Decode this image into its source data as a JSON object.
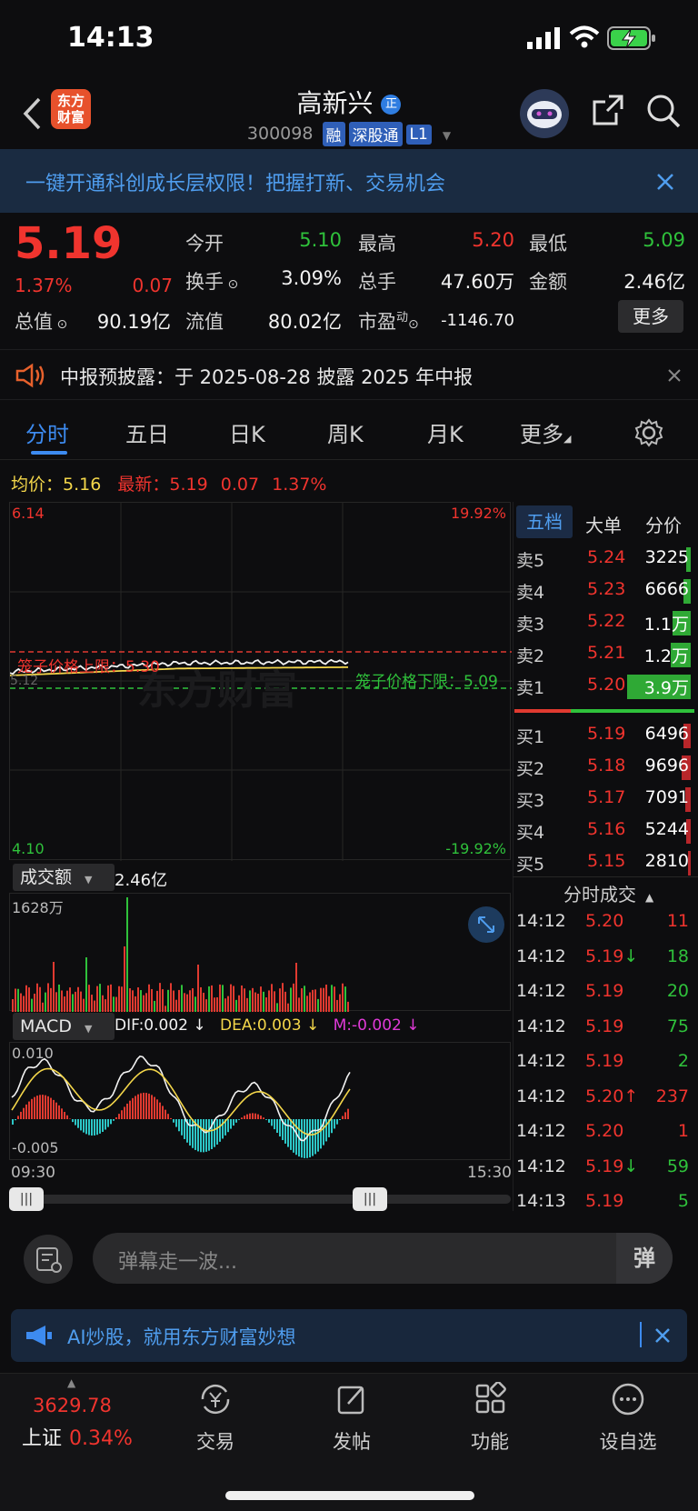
{
  "status": {
    "time": "14:13"
  },
  "header": {
    "logo_text": "东方\n财富",
    "logo_line1": "东方",
    "logo_line2": "财富",
    "stock_name": "高新兴",
    "name_badge": "正",
    "stock_code": "300098",
    "tags": [
      "融",
      "深股通",
      "L1"
    ]
  },
  "banner": {
    "text": "一键开通科创成长层权限！把握打新、交易机会"
  },
  "quote": {
    "price": "5.19",
    "change_pct": "1.37%",
    "change": "0.07",
    "fields": [
      {
        "label": "今开",
        "value": "5.10",
        "color": "green"
      },
      {
        "label": "最高",
        "value": "5.20",
        "color": "red"
      },
      {
        "label": "最低",
        "value": "5.09",
        "color": "green"
      },
      {
        "label": "换手",
        "value": "3.09%",
        "color": "white"
      },
      {
        "label": "总手",
        "value": "47.60万",
        "color": "white"
      },
      {
        "label": "金额",
        "value": "2.46亿",
        "color": "white"
      },
      {
        "label": "总值",
        "value": "90.19亿",
        "color": "white"
      },
      {
        "label": "流值",
        "value": "80.02亿",
        "color": "white"
      },
      {
        "label": "市盈",
        "value": "-1146.70",
        "color": "white"
      }
    ],
    "pe_sup": "动",
    "more_button": "更多"
  },
  "notice": {
    "text": "中报预披露：于 2025-08-28 披露 2025 年中报"
  },
  "tabs": [
    "分时",
    "五日",
    "日K",
    "周K",
    "月K",
    "更多"
  ],
  "chart_info": {
    "avg_label": "均价：",
    "avg_value": "5.16",
    "latest_label": "最新：",
    "latest_value": "5.19",
    "latest_change": "0.07",
    "latest_pct": "1.37%"
  },
  "chart": {
    "max_price": "6.14",
    "max_pct": "19.92%",
    "min_price": "4.10",
    "min_pct": "-19.92%",
    "upper_limit_label": "笼子价格上限：5.30",
    "lower_limit_label": "笼子价格下限：5.09",
    "prev_close_label": "5.12",
    "watermark": "东方财富"
  },
  "volume": {
    "selector": "成交额",
    "total": "2.46亿",
    "max_label": "1628万"
  },
  "macd": {
    "selector": "MACD",
    "dif": "DIF:0.002 ↓",
    "dea": "DEA:0.003 ↓",
    "m": "M:-0.002 ↓",
    "top": "0.010",
    "bottom": "-0.005"
  },
  "time_axis": {
    "start": "09:30",
    "end": "15:30"
  },
  "orderbook": {
    "tabs": [
      "五档",
      "大单",
      "分价"
    ],
    "sells": [
      {
        "label": "卖5",
        "price": "5.24",
        "vol": "3225",
        "bar": 0.05
      },
      {
        "label": "卖4",
        "price": "5.23",
        "vol": "6666",
        "bar": 0.08
      },
      {
        "label": "卖3",
        "price": "5.22",
        "vol": "1.1万",
        "bar": 0.2
      },
      {
        "label": "卖2",
        "price": "5.21",
        "vol": "1.2万",
        "bar": 0.22
      },
      {
        "label": "卖1",
        "price": "5.20",
        "vol": "3.9万",
        "bar": 0.7
      }
    ],
    "buys": [
      {
        "label": "买1",
        "price": "5.19",
        "vol": "6496",
        "bar": 0.08
      },
      {
        "label": "买2",
        "price": "5.18",
        "vol": "9696",
        "bar": 0.1
      },
      {
        "label": "买3",
        "price": "5.17",
        "vol": "7091",
        "bar": 0.06
      },
      {
        "label": "买4",
        "price": "5.16",
        "vol": "5244",
        "bar": 0.05
      },
      {
        "label": "买5",
        "price": "5.15",
        "vol": "2810",
        "bar": 0.03
      }
    ]
  },
  "ticks": {
    "title": "分时成交",
    "rows": [
      {
        "time": "14:12",
        "price": "5.20",
        "arrow": "",
        "vol": "11",
        "pcolor": "red",
        "vcolor": "red"
      },
      {
        "time": "14:12",
        "price": "5.19",
        "arrow": "↓",
        "vol": "18",
        "pcolor": "red",
        "vcolor": "green"
      },
      {
        "time": "14:12",
        "price": "5.19",
        "arrow": "",
        "vol": "20",
        "pcolor": "red",
        "vcolor": "green"
      },
      {
        "time": "14:12",
        "price": "5.19",
        "arrow": "",
        "vol": "75",
        "pcolor": "red",
        "vcolor": "green"
      },
      {
        "time": "14:12",
        "price": "5.19",
        "arrow": "",
        "vol": "2",
        "pcolor": "red",
        "vcolor": "green"
      },
      {
        "time": "14:12",
        "price": "5.20",
        "arrow": "↑",
        "vol": "237",
        "pcolor": "red",
        "vcolor": "red"
      },
      {
        "time": "14:12",
        "price": "5.20",
        "arrow": "",
        "vol": "1",
        "pcolor": "red",
        "vcolor": "red"
      },
      {
        "time": "14:12",
        "price": "5.19",
        "arrow": "↓",
        "vol": "59",
        "pcolor": "red",
        "vcolor": "green"
      },
      {
        "time": "14:13",
        "price": "5.19",
        "arrow": "",
        "vol": "5",
        "pcolor": "red",
        "vcolor": "green"
      }
    ]
  },
  "danmaku": {
    "placeholder": "弹幕走一波...",
    "send": "弹"
  },
  "ai_banner": {
    "text": "AI炒股，就用东方财富妙想"
  },
  "bottom": {
    "index_value": "3629.78",
    "index_name": "上证",
    "index_pct": "0.34%",
    "nav": [
      {
        "label": "交易",
        "icon": "yen-cycle-icon"
      },
      {
        "label": "发帖",
        "icon": "edit-icon"
      },
      {
        "label": "功能",
        "icon": "grid-icon"
      },
      {
        "label": "设自选",
        "icon": "more-dots-icon"
      }
    ]
  },
  "colors": {
    "up": "#f0342e",
    "down": "#2fc13b",
    "avg": "#f3d64a",
    "accent": "#2f7de1"
  }
}
